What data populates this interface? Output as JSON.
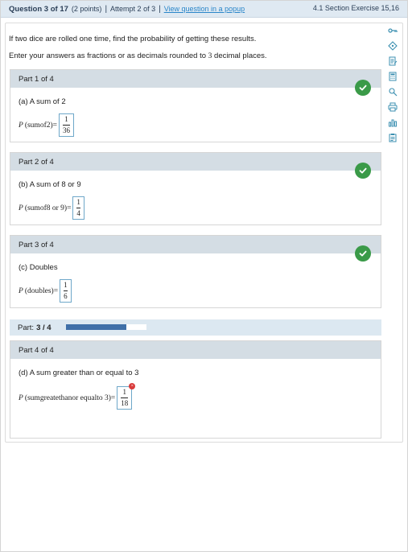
{
  "header": {
    "question_label": "Question 3 of 17",
    "points": "(2 points)",
    "separator": "|",
    "attempt": "Attempt 2 of 3",
    "popup_link": "View question in a popup",
    "section": "4.1 Section Exercise 15,16"
  },
  "intro": {
    "line1": "If two dice are rolled one time, find the probability of getting these results.",
    "line2_a": "Enter your answers as fractions or as decimals rounded to ",
    "line2_num": "3",
    "line2_b": " decimal places."
  },
  "toolbar": {
    "icons": [
      "key-icon",
      "hint-icon",
      "notes-icon",
      "calculator-icon",
      "search-icon",
      "print-icon",
      "chart-icon",
      "clipboard-icon"
    ]
  },
  "parts": [
    {
      "header": "Part 1 of 4",
      "question": "(a) A sum of 2",
      "prob_var": "P",
      "prob_arg": "(sumof2)",
      "eq": "=",
      "numerator": "1",
      "denominator": "36",
      "status": "correct"
    },
    {
      "header": "Part 2 of 4",
      "question": "(b) A sum of 8 or 9",
      "prob_var": "P",
      "prob_arg": "(sumof8 or 9)",
      "eq": "=",
      "numerator": "1",
      "denominator": "4",
      "status": "correct"
    },
    {
      "header": "Part 3 of 4",
      "question": "(c) Doubles",
      "prob_var": "P",
      "prob_arg": "(doubles)",
      "eq": "=",
      "numerator": "1",
      "denominator": "6",
      "status": "correct"
    },
    {
      "header": "Part 4 of 4",
      "question": "(d) A sum greater than or equal to 3",
      "prob_var": "P",
      "prob_arg": "(sumgreatethanor equalto 3)",
      "eq": "=",
      "numerator": "1",
      "denominator": "18",
      "status": "error"
    }
  ],
  "progress": {
    "label": "Part:",
    "value": "3 / 4",
    "fraction": 0.75
  },
  "colors": {
    "header_bg": "#dfe9f2",
    "part_header_bg": "#d4dde4",
    "check_green": "#3a9a48",
    "progress_fill": "#3f6fa8",
    "link_blue": "#2a86c9",
    "error_red": "#d93b3b"
  }
}
